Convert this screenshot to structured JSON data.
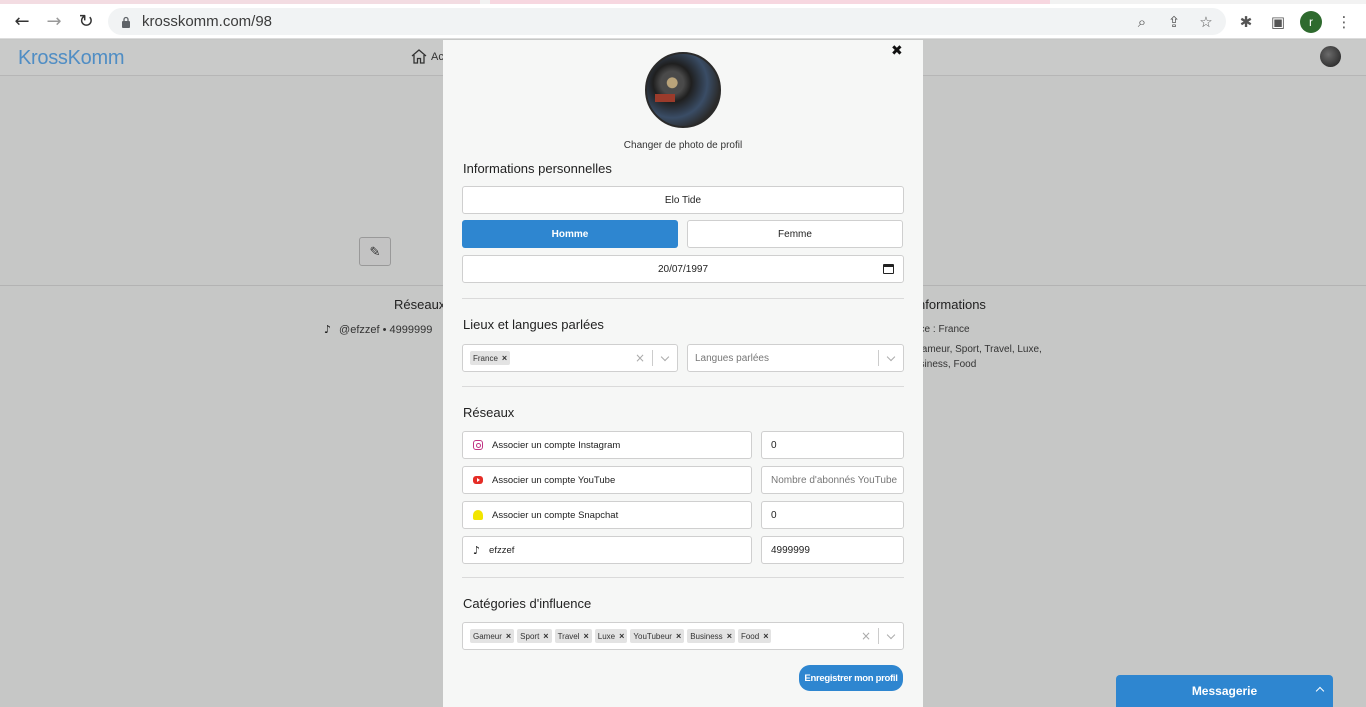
{
  "browser": {
    "url": "krosskomm.com/98",
    "avatar_letter": "r"
  },
  "site": {
    "logo": "KrossKomm",
    "nav_home_partial": "Ac",
    "left_section_title": "Réseaux",
    "left_tiktok_text": "@efzzef • 4999999",
    "right_section_title": "nformations",
    "right_line1": "nce : France",
    "right_line2": "Gameur, Sport, Travel, Luxe, usiness, Food"
  },
  "modal": {
    "change_photo_label": "Changer de photo de profil",
    "personal_title": "Informations personnelles",
    "name_value": "Elo Tide",
    "gender_options": [
      "Homme",
      "Femme"
    ],
    "gender_selected": "Homme",
    "birthdate": "20/07/1997",
    "places_title": "Lieux et langues parlées",
    "countries": [
      "France"
    ],
    "languages_placeholder": "Langues parlées",
    "networks_title": "Réseaux",
    "networks": [
      {
        "icon": "instagram-icon",
        "label": "Associer un compte Instagram",
        "count": "0",
        "count_placeholder": ""
      },
      {
        "icon": "youtube-icon",
        "label": "Associer un compte YouTube",
        "count": "",
        "count_placeholder": "Nombre d'abonnés YouTube"
      },
      {
        "icon": "snapchat-icon",
        "label": "Associer un compte Snapchat",
        "count": "0",
        "count_placeholder": ""
      },
      {
        "icon": "tiktok-icon",
        "label": "efzzef",
        "count": "4999999",
        "count_placeholder": ""
      }
    ],
    "categories_title": "Catégories d'influence",
    "categories": [
      "Gameur",
      "Sport",
      "Travel",
      "Luxe",
      "YouTubeur",
      "Business",
      "Food"
    ],
    "save_label": "Enregistrer mon profil"
  },
  "messagerie": {
    "label": "Messagerie"
  },
  "colors": {
    "accent": "#2e86d0",
    "logo": "#4f8dc4",
    "overlay_bg": "#c6c7c6"
  }
}
